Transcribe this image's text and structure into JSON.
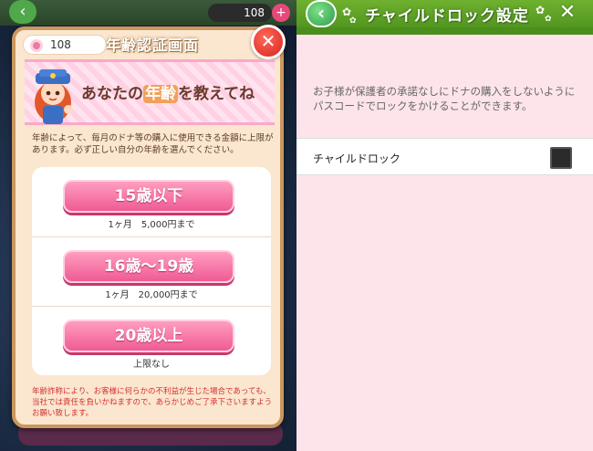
{
  "left_screen": {
    "background": {
      "coin_count": "108"
    },
    "dialog": {
      "title": "年齢認証画面",
      "coin_count": "108",
      "banner_text_before": "あなたの",
      "banner_text_highlight": "年齢",
      "banner_text_after": "を教えてね",
      "description": "年齢によって、毎月のドナ等の購入に使用できる金額に上限があります。必ず正しい自分の年齢を選んでください。",
      "options": [
        {
          "label": "15歳以下",
          "limit": "1ヶ月　5,000円まで"
        },
        {
          "label": "16歳〜19歳",
          "limit": "1ヶ月　20,000円まで"
        },
        {
          "label": "20歳以上",
          "limit": "上限なし"
        }
      ],
      "footnote": "年齢詐称により、お客様に何らかの不利益が生じた場合であっても、当社では責任を負いかねますので、あらかじめご了承下さいますようお願い致します。"
    }
  },
  "right_screen": {
    "header": {
      "title": "チャイルドロック設定"
    },
    "info_text": "お子様が保護者の承諾なしにドナの購入をしないようにパスコードでロックをかけることができます。",
    "setting": {
      "label": "チャイルドロック",
      "checked": false
    }
  },
  "colors": {
    "accent_pink": "#f05a94",
    "header_green": "#4a8f1c",
    "close_red": "#d8221e",
    "background_pink": "#fde4ea"
  }
}
